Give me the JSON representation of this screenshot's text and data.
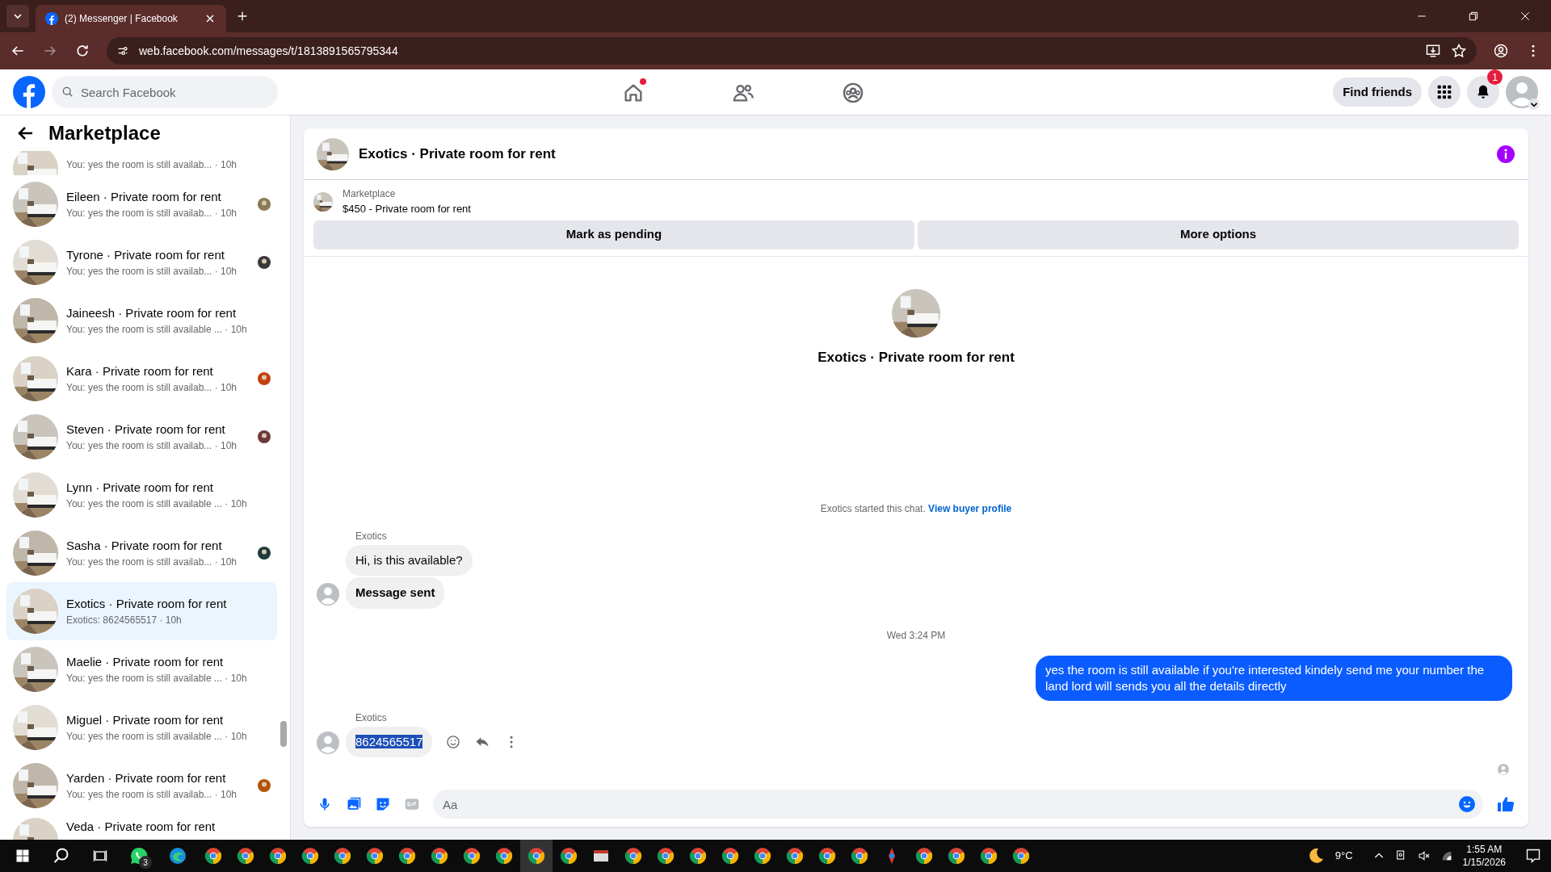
{
  "browser": {
    "tab_title": "(2) Messenger | Facebook",
    "url": "web.facebook.com/messages/t/1813891565795344"
  },
  "header": {
    "search_placeholder": "Search Facebook",
    "nav": [
      {
        "dot": true
      },
      {
        "dot": false
      },
      {
        "dot": false
      }
    ],
    "find_friends": "Find friends",
    "notification_count": "1"
  },
  "sidebar": {
    "title": "Marketplace",
    "items": [
      {
        "kind": "partial",
        "subtitle": "You: yes the room is still availab... · 10h",
        "selected": false,
        "seen": false
      },
      {
        "kind": "full",
        "title": "Eileen · Private room for rent",
        "subtitle": "You: yes the room is still availab... · 10h",
        "selected": false,
        "seen": true
      },
      {
        "kind": "full",
        "title": "Tyrone · Private room for rent",
        "subtitle": "You: yes the room is still availab... · 10h",
        "selected": false,
        "seen": true
      },
      {
        "kind": "full",
        "title": "Jaineesh · Private room for rent",
        "subtitle": "You: yes the room is still available ... · 10h",
        "selected": false,
        "seen": false
      },
      {
        "kind": "full",
        "title": "Kara · Private room for rent",
        "subtitle": "You: yes the room is still availab... · 10h",
        "selected": false,
        "seen": true
      },
      {
        "kind": "full",
        "title": "Steven · Private room for rent",
        "subtitle": "You: yes the room is still availab... · 10h",
        "selected": false,
        "seen": true
      },
      {
        "kind": "full",
        "title": "Lynn · Private room for rent",
        "subtitle": "You: yes the room is still available ... · 10h",
        "selected": false,
        "seen": false
      },
      {
        "kind": "full",
        "title": "Sasha · Private room for rent",
        "subtitle": "You: yes the room is still availab... · 10h",
        "selected": false,
        "seen": true
      },
      {
        "kind": "full",
        "title": "Exotics · Private room for rent",
        "subtitle": "Exotics: 8624565517 · 10h",
        "selected": true,
        "seen": false
      },
      {
        "kind": "full",
        "title": "Maelie · Private room for rent",
        "subtitle": "You: yes the room is still available ... · 10h",
        "selected": false,
        "seen": false
      },
      {
        "kind": "full",
        "title": "Miguel · Private room for rent",
        "subtitle": "You: yes the room is still available ... · 10h",
        "selected": false,
        "seen": false
      },
      {
        "kind": "full",
        "title": "Yarden · Private room for rent",
        "subtitle": "You: yes the room is still availab... · 10h",
        "selected": false,
        "seen": true
      },
      {
        "kind": "cut",
        "title": "Veda · Private room for rent",
        "selected": false,
        "seen": false
      }
    ]
  },
  "chat": {
    "title": "Exotics · Private room for rent",
    "listing": {
      "label": "Marketplace",
      "price_title": "$450 - Private room for rent"
    },
    "buttons": [
      "Mark as pending",
      "More options"
    ],
    "intro_name": "Exotics · Private room for rent",
    "messages": [
      {
        "kind": "notice",
        "text": "Exotics started this chat.",
        "link": "View buyer profile"
      },
      {
        "kind": "incoming",
        "sender": "Exotics",
        "bubbles": [
          {
            "text": "Hi, is this available?",
            "bold": false,
            "highlighted": false
          },
          {
            "text": "Message sent",
            "bold": true,
            "highlighted": false
          }
        ],
        "actions": false
      },
      {
        "kind": "timestamp",
        "text": "Wed 3:24 PM"
      },
      {
        "kind": "outgoing",
        "text": "yes the room is still available if you're interested kindely send me your number the land lord will sends you all the details directly"
      },
      {
        "kind": "incoming",
        "sender": "Exotics",
        "bubbles": [
          {
            "text": "8624565517",
            "bold": false,
            "highlighted": true
          }
        ],
        "actions": true
      }
    ],
    "composer_placeholder": "Aa"
  },
  "taskbar": {
    "whatsapp_badge": "3",
    "apps": [
      {
        "kind": "chrome",
        "active": false
      },
      {
        "kind": "chrome",
        "active": false
      },
      {
        "kind": "chrome",
        "active": false
      },
      {
        "kind": "chrome",
        "active": false
      },
      {
        "kind": "chrome",
        "active": false
      },
      {
        "kind": "chrome",
        "active": false
      },
      {
        "kind": "chrome",
        "active": false
      },
      {
        "kind": "chrome",
        "active": false
      },
      {
        "kind": "chrome",
        "active": false
      },
      {
        "kind": "chrome",
        "active": false
      },
      {
        "kind": "chrome",
        "active": true
      },
      {
        "kind": "chrome",
        "active": false
      },
      {
        "kind": "files",
        "active": false
      },
      {
        "kind": "chrome",
        "active": false
      },
      {
        "kind": "chrome",
        "active": false
      },
      {
        "kind": "chrome",
        "active": false
      },
      {
        "kind": "chrome",
        "active": false
      },
      {
        "kind": "chrome",
        "active": false
      },
      {
        "kind": "chrome",
        "active": false
      },
      {
        "kind": "chrome",
        "active": false
      },
      {
        "kind": "chrome",
        "active": false
      },
      {
        "kind": "app",
        "active": false
      },
      {
        "kind": "chrome",
        "active": false
      },
      {
        "kind": "chrome",
        "active": false
      },
      {
        "kind": "chrome",
        "active": false
      },
      {
        "kind": "chrome",
        "active": false
      }
    ],
    "temperature": "9°C",
    "time": "1:55 AM",
    "date": "1/15/2026"
  }
}
